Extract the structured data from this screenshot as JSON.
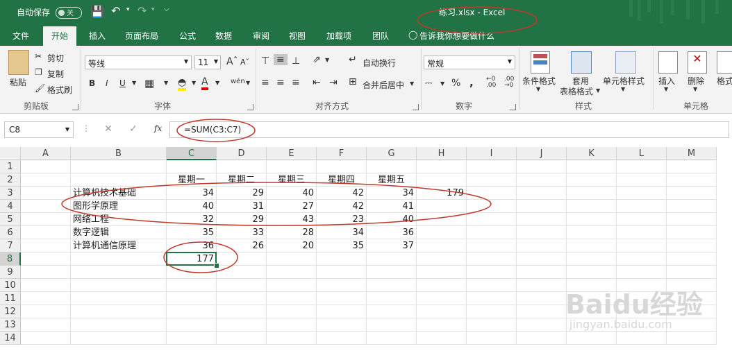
{
  "titlebar": {
    "autosave_label": "自动保存",
    "autosave_state": "关",
    "title": "练习.xlsx  -  Excel"
  },
  "menu": {
    "tabs": [
      "文件",
      "开始",
      "插入",
      "页面布局",
      "公式",
      "数据",
      "审阅",
      "视图",
      "加载项",
      "团队"
    ],
    "active_tab": "开始",
    "tell_me": "告诉我你想要做什么"
  },
  "ribbon": {
    "clipboard": {
      "paste": "粘贴",
      "cut": "剪切",
      "copy": "复制",
      "format_painter": "格式刷",
      "group": "剪贴板"
    },
    "font": {
      "font_name": "等线",
      "font_size": "11",
      "bold": "B",
      "italic": "I",
      "underline": "U",
      "phonetic": "wén",
      "group": "字体"
    },
    "alignment": {
      "wrap": "自动换行",
      "merge": "合并后居中",
      "group": "对齐方式"
    },
    "number": {
      "format": "常规",
      "percent": "%",
      "comma": ",",
      "group": "数字"
    },
    "styles": {
      "conditional": "条件格式",
      "table1": "套用",
      "table2": "表格格式",
      "cell_styles": "单元格样式",
      "group": "样式"
    },
    "cells": {
      "insert": "插入",
      "delete": "删除",
      "format": "格式",
      "group": "单元格"
    }
  },
  "formula_bar": {
    "name_box": "C8",
    "fx": "fx",
    "formula": "=SUM(C3:C7)"
  },
  "sheet": {
    "columns": [
      "A",
      "B",
      "C",
      "D",
      "E",
      "F",
      "G",
      "H",
      "I",
      "J",
      "K",
      "L",
      "M"
    ],
    "selected_column": "C",
    "rows": [
      "1",
      "2",
      "3",
      "4",
      "5",
      "6",
      "7",
      "8",
      "9",
      "10",
      "11",
      "12",
      "13",
      "14"
    ],
    "selected_row": "8",
    "headers": {
      "C": "星期一",
      "D": "星期二",
      "E": "星期三",
      "F": "星期四",
      "G": "星期五"
    },
    "data_rows": [
      {
        "row": "3",
        "name": "计算机技术基础",
        "values": [
          34,
          29,
          40,
          42,
          34
        ]
      },
      {
        "row": "4",
        "name": "图形学原理",
        "values": [
          40,
          31,
          27,
          42,
          41
        ]
      },
      {
        "row": "5",
        "name": "网络工程",
        "values": [
          32,
          29,
          43,
          23,
          40
        ]
      },
      {
        "row": "6",
        "name": "数字逻辑",
        "values": [
          35,
          33,
          28,
          34,
          36
        ]
      },
      {
        "row": "7",
        "name": "计算机通信原理",
        "values": [
          36,
          26,
          20,
          35,
          37
        ]
      }
    ],
    "h3_value": "179",
    "c8_value": "177",
    "selected_cell": "C8"
  },
  "watermark": {
    "brand": "Baidu经验",
    "url": "jingyan.baidu.com"
  },
  "colors": {
    "excel_green": "#217346",
    "annotation_red": "#c0392b"
  }
}
